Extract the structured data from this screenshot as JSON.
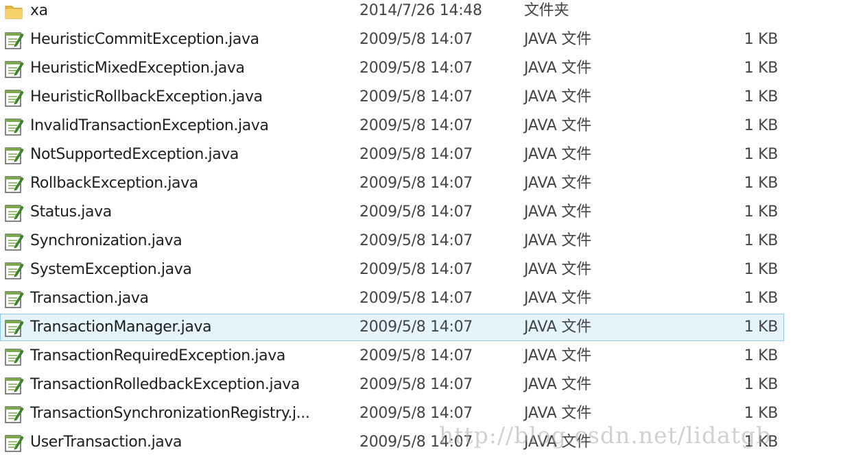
{
  "folder": {
    "name": "xa",
    "date": "2014/7/26 14:48",
    "type": "文件夹",
    "icon": "folder-icon"
  },
  "files": [
    {
      "name": "HeuristicCommitException.java",
      "date": "2009/5/8 14:07",
      "type": "JAVA 文件",
      "size": "1 KB"
    },
    {
      "name": "HeuristicMixedException.java",
      "date": "2009/5/8 14:07",
      "type": "JAVA 文件",
      "size": "1 KB"
    },
    {
      "name": "HeuristicRollbackException.java",
      "date": "2009/5/8 14:07",
      "type": "JAVA 文件",
      "size": "1 KB"
    },
    {
      "name": "InvalidTransactionException.java",
      "date": "2009/5/8 14:07",
      "type": "JAVA 文件",
      "size": "1 KB"
    },
    {
      "name": "NotSupportedException.java",
      "date": "2009/5/8 14:07",
      "type": "JAVA 文件",
      "size": "1 KB"
    },
    {
      "name": "RollbackException.java",
      "date": "2009/5/8 14:07",
      "type": "JAVA 文件",
      "size": "1 KB"
    },
    {
      "name": "Status.java",
      "date": "2009/5/8 14:07",
      "type": "JAVA 文件",
      "size": "1 KB"
    },
    {
      "name": "Synchronization.java",
      "date": "2009/5/8 14:07",
      "type": "JAVA 文件",
      "size": "1 KB"
    },
    {
      "name": "SystemException.java",
      "date": "2009/5/8 14:07",
      "type": "JAVA 文件",
      "size": "1 KB"
    },
    {
      "name": "Transaction.java",
      "date": "2009/5/8 14:07",
      "type": "JAVA 文件",
      "size": "1 KB"
    },
    {
      "name": "TransactionManager.java",
      "date": "2009/5/8 14:07",
      "type": "JAVA 文件",
      "size": "1 KB",
      "selected": true
    },
    {
      "name": "TransactionRequiredException.java",
      "date": "2009/5/8 14:07",
      "type": "JAVA 文件",
      "size": "1 KB"
    },
    {
      "name": "TransactionRolledbackException.java",
      "date": "2009/5/8 14:07",
      "type": "JAVA 文件",
      "size": "1 KB"
    },
    {
      "name": "TransactionSynchronizationRegistry.j...",
      "date": "2009/5/8 14:07",
      "type": "JAVA 文件",
      "size": "1 KB"
    },
    {
      "name": "UserTransaction.java",
      "date": "2009/5/8 14:07",
      "type": "JAVA 文件",
      "size": "1 KB"
    }
  ],
  "file_icon": "java-file-icon",
  "colors": {
    "selection_bg": "#e5f3fb",
    "selection_border": "#8fc9eb",
    "folder": "#f3c64c"
  },
  "watermark": "http://blog.csdn.net/lidatgb"
}
